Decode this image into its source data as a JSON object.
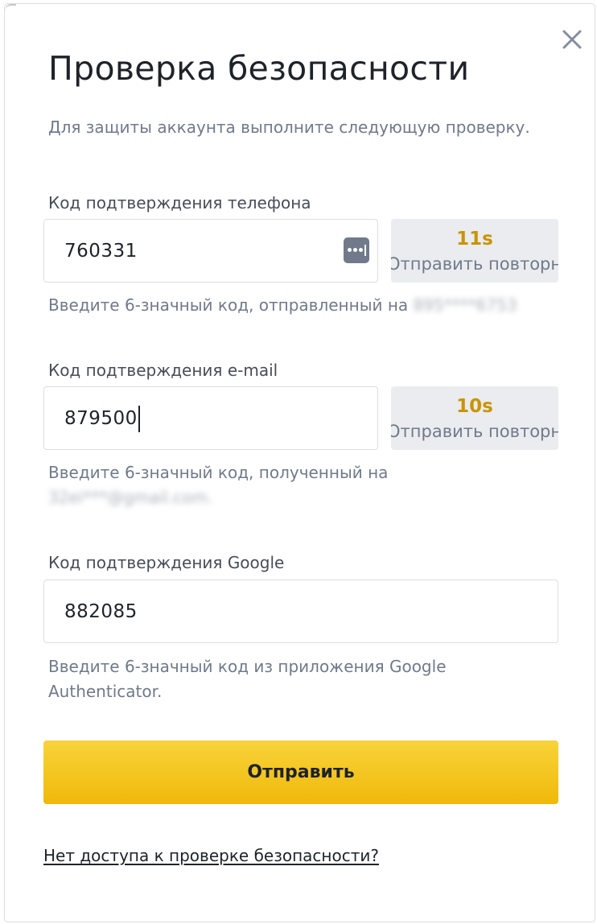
{
  "modal": {
    "title": "Проверка безопасности",
    "subtitle": "Для защиты аккаунта выполните следующую проверку.",
    "close_icon": "close-icon"
  },
  "phone": {
    "label": "Код подтверждения телефона",
    "value": "760331",
    "timer": "11s",
    "resend_label": "Отправить повторно",
    "hint_prefix": "Введите 6-значный код, отправленный на",
    "masked_phone": "895****6753",
    "autofill_icon": "password-manager-icon"
  },
  "email": {
    "label": "Код подтверждения e-mail",
    "value": "879500",
    "timer": "10s",
    "resend_label": "Отправить повторно",
    "hint_prefix": "Введите 6-значный код, полученный на",
    "masked_email": "32ei***@gmail.com."
  },
  "google": {
    "label": "Код подтверждения Google",
    "value": "882085",
    "hint": "Введите 6-значный код из приложения Google Authenticator."
  },
  "submit_label": "Отправить",
  "help_link": "Нет доступа к проверке безопасности?",
  "colors": {
    "accent": "#f0b90b",
    "timer": "#c99400",
    "text_primary": "#1e2329",
    "text_secondary": "#707a8a"
  }
}
